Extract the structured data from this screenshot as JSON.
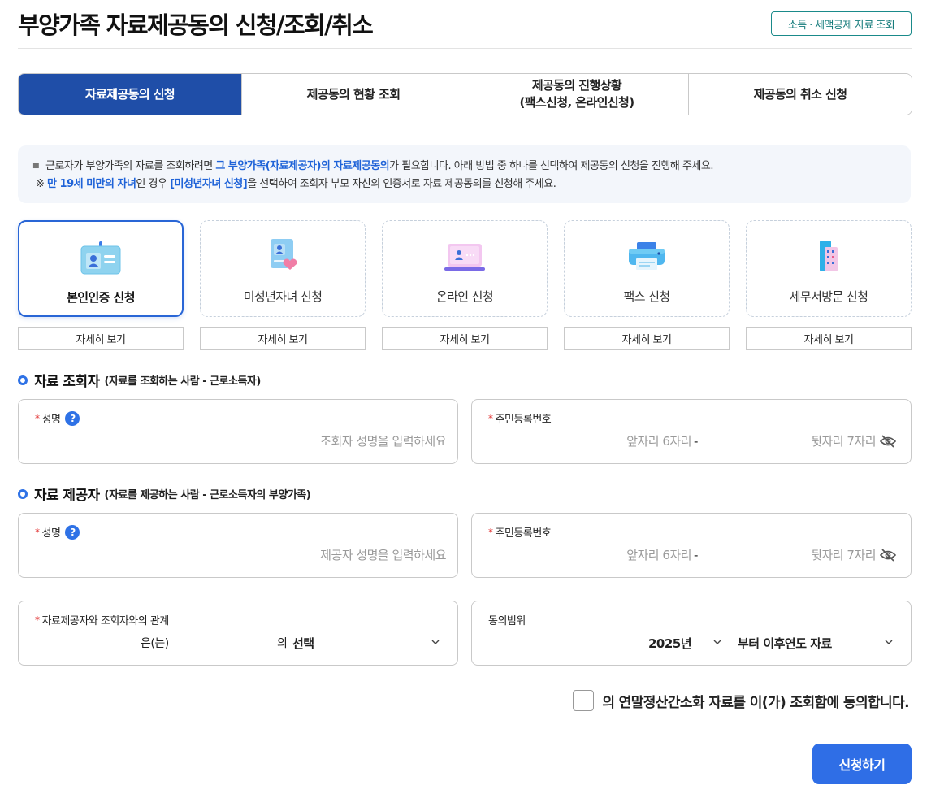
{
  "page": {
    "title": "부양가족 자료제공동의 신청/조회/취소",
    "top_link": "소득 · 세액공제 자료 조회"
  },
  "tabs": [
    {
      "label": "자료제공동의 신청"
    },
    {
      "label": "제공동의 현황 조회"
    },
    {
      "label": "제공동의 진행상황\n(팩스신청, 온라인신청)"
    },
    {
      "label": "제공동의 취소 신청"
    }
  ],
  "notice": {
    "line1_pre": "근로자가 부양가족의 자료를 조회하려면 ",
    "line1_hl": "그 부양가족(자료제공자)의 자료제공동의",
    "line1_post": "가 필요합니다. 아래 방법 중 하나를 선택하여 제공동의 신청을 진행해 주세요.",
    "line2_mark": "※ ",
    "line2_hl1": "만 19세 미만의 자녀",
    "line2_mid": "인 경우 ",
    "line2_hl2": "[미성년자녀 신청]",
    "line2_post": "을 선택하여 조회자 부모 자신의 인증서로 자료 제공동의를 신청해 주세요."
  },
  "methods": [
    {
      "label": "본인인증 신청",
      "icon": "id-card-icon",
      "detail": "자세히 보기"
    },
    {
      "label": "미성년자녀 신청",
      "icon": "child-document-icon",
      "detail": "자세히 보기"
    },
    {
      "label": "온라인 신청",
      "icon": "laptop-icon",
      "detail": "자세히 보기"
    },
    {
      "label": "팩스 신청",
      "icon": "fax-printer-icon",
      "detail": "자세히 보기"
    },
    {
      "label": "세무서방문 신청",
      "icon": "office-building-icon",
      "detail": "자세히 보기"
    }
  ],
  "viewer": {
    "title": "자료 조회자",
    "sub": "(자료를 조회하는 사람 - 근로소득자)",
    "name_label": "성명",
    "name_placeholder": "조회자 성명을 입력하세요",
    "rrn_label": "주민등록번호",
    "rrn_front": "앞자리 6자리",
    "rrn_dash": "-",
    "rrn_back": "뒷자리 7자리"
  },
  "provider": {
    "title": "자료 제공자",
    "sub": "(자료를 제공하는 사람 - 근로소득자의 부양가족)",
    "name_label": "성명",
    "name_placeholder": "제공자 성명을 입력하세요",
    "rrn_label": "주민등록번호",
    "rrn_front": "앞자리 6자리",
    "rrn_dash": "-",
    "rrn_back": "뒷자리 7자리"
  },
  "relation": {
    "label": "자료제공자와 조회자와의 관계",
    "particle1": "은(는)",
    "particle2": "의",
    "selected": "선택"
  },
  "scope": {
    "label": "동의범위",
    "year": "2025년",
    "range": "부터 이후연도 자료"
  },
  "agree_text": "의 연말정산간소화 자료를 이(가) 조회함에 동의합니다.",
  "submit_label": "신청하기",
  "colors": {
    "primary": "#1f4ea8",
    "accent": "#2f6ee6",
    "required": "#e02a2a"
  }
}
